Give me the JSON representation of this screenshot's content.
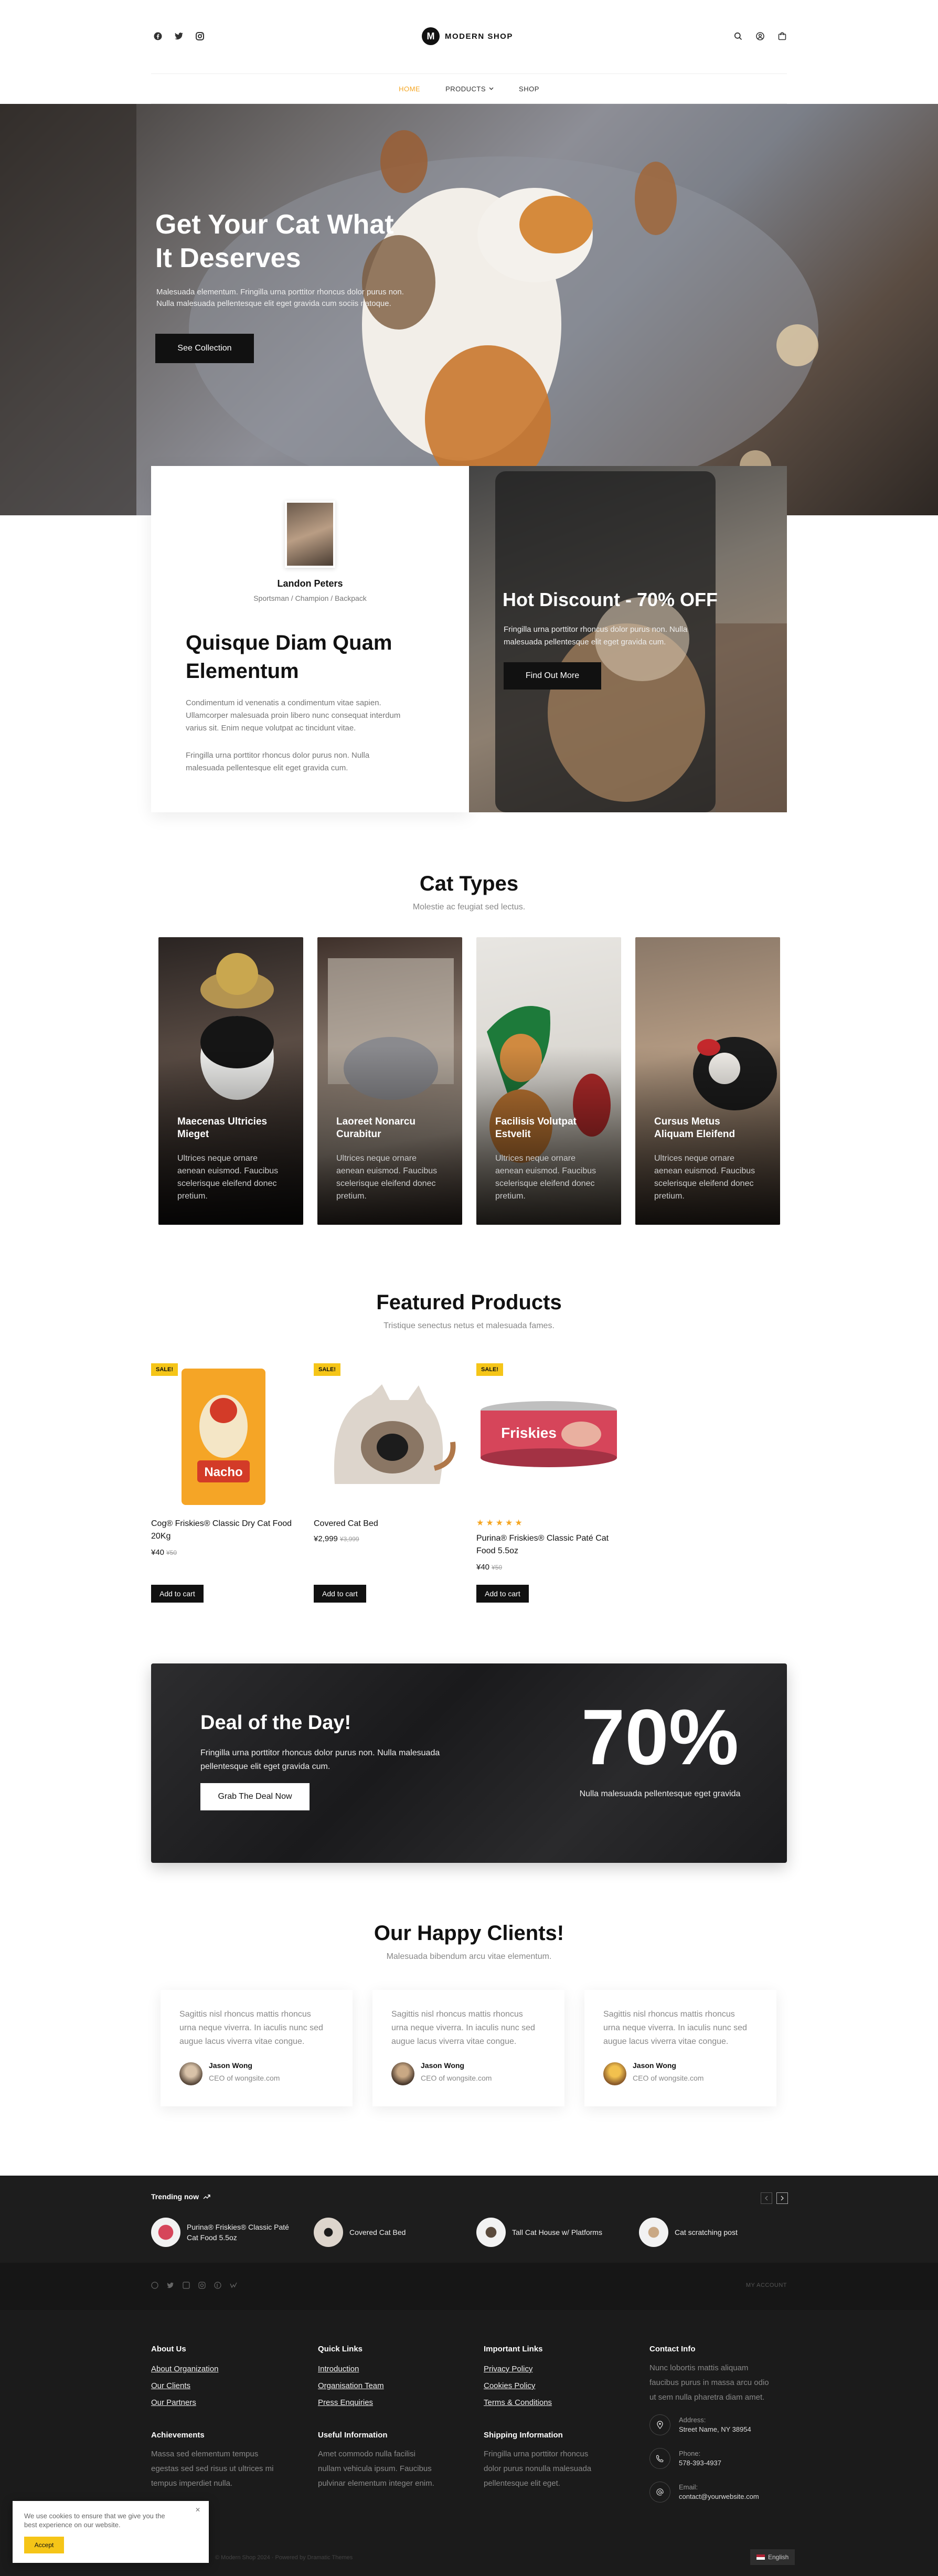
{
  "header": {
    "brand_mark": "M",
    "brand_name": "MODERN SHOP",
    "social_icons": [
      "facebook-icon",
      "twitter-icon",
      "instagram-icon"
    ],
    "utility_icons": [
      "search-icon",
      "account-icon",
      "cart-icon"
    ],
    "nav": [
      {
        "label": "HOME",
        "active": true
      },
      {
        "label": "PRODUCTS",
        "dropdown": true
      },
      {
        "label": "SHOP"
      }
    ]
  },
  "hero": {
    "title_line1": "Get Your Cat What",
    "title_line2": "It Deserves",
    "text_line1": "Malesuada elementum. Fringilla urna porttitor rhoncus dolor purus non.",
    "text_line2": "Nulla malesuada pellentesque elit eget gravida cum sociis natoque.",
    "button": "See Collection"
  },
  "profile": {
    "name": "Landon Peters",
    "role": "Sportsman / Champion / Backpack",
    "heading_line1": "Quisque Diam Quam",
    "heading_line2": "Elementum",
    "para1_line1": "Condimentum id venenatis a condimentum vitae sapien.",
    "para1_line2": "Ullamcorper malesuada proin libero nunc consequat interdum",
    "para1_line3": "varius sit. Enim neque volutpat ac tincidunt vitae.",
    "para2_line1": "Fringilla urna porttitor rhoncus dolor purus non. Nulla",
    "para2_line2": "malesuada pellentesque elit eget gravida cum."
  },
  "promo": {
    "title": "Hot Discount - 70% OFF",
    "text_line1": "Fringilla urna porttitor rhoncus dolor purus non. Nulla",
    "text_line2": "malesuada pellentesque elit eget gravida cum.",
    "button": "Find Out More"
  },
  "cat_types": {
    "title": "Cat Types",
    "subtitle": "Molestie ac feugiat sed lectus.",
    "cards": [
      {
        "title_line1": "Maecenas Ultricies",
        "title_line2": "Mieget",
        "desc": "Ultrices neque ornare aenean euismod. Faucibus scelerisque eleifend donec pretium.",
        "bg": "#3b3532"
      },
      {
        "title_line1": "Laoreet Nonarcu",
        "title_line2": "Curabitur",
        "desc": "Ultrices neque ornare aenean euismod. Faucibus scelerisque eleifend donec pretium.",
        "bg": "#6b5c54"
      },
      {
        "title_line1": "Facilisis Volutpat",
        "title_line2": "Estvelit",
        "desc": "Ultrices neque ornare aenean euismod. Faucibus scelerisque eleifend donec pretium.",
        "bg": "#8a8a86"
      },
      {
        "title_line1": "Cursus Metus",
        "title_line2": "Aliquam Eleifend",
        "desc": "Ultrices neque ornare aenean euismod. Faucibus scelerisque eleifend donec pretium.",
        "bg": "#6a5d4e"
      }
    ]
  },
  "featured": {
    "title": "Featured Products",
    "subtitle": "Tristique senectus netus et malesuada fames.",
    "sale_badge": "SALE!",
    "add_to_cart": "Add to cart",
    "products": [
      {
        "name_line1": "Cog® Friskies® Classic Dry Cat Food",
        "name_line2": "20Kg",
        "price": "¥40",
        "old_price": "¥50",
        "rating": 0
      },
      {
        "name_line1": "Covered Cat Bed",
        "name_line2": "",
        "price": "¥2,999",
        "old_price": "¥3,999",
        "rating": 0
      },
      {
        "name_line1": "Purina® Friskies® Classic Paté Cat",
        "name_line2": "Food 5.5oz",
        "price": "¥40",
        "old_price": "¥50",
        "rating": 5
      }
    ],
    "bag_text_brand": "Nacho",
    "can_text_brand": "Friskies"
  },
  "deal": {
    "title": "Deal of the Day!",
    "text_line1": "Fringilla urna porttitor rhoncus dolor purus non. Nulla malesuada",
    "text_line2": "pellentesque elit eget gravida cum.",
    "button": "Grab The Deal Now",
    "big": "70%",
    "big_caption": "Nulla malesuada pellentesque eget gravida"
  },
  "clients": {
    "title": "Our Happy Clients!",
    "subtitle": "Malesuada bibendum arcu vitae elementum.",
    "items": [
      {
        "quote_line1": "Sagittis nisl rhoncus mattis rhoncus",
        "quote_line2": "urna neque viverra. In iaculis nunc sed",
        "quote_line3": "augue lacus viverra vitae congue.",
        "name": "Jason Wong",
        "role": "CEO of wongsite.com"
      },
      {
        "quote_line1": "Sagittis nisl rhoncus mattis rhoncus",
        "quote_line2": "urna neque viverra. In iaculis nunc sed",
        "quote_line3": "augue lacus viverra vitae congue.",
        "name": "Jason Wong",
        "role": "CEO of wongsite.com"
      },
      {
        "quote_line1": "Sagittis nisl rhoncus mattis rhoncus",
        "quote_line2": "urna neque viverra. In iaculis nunc sed",
        "quote_line3": "augue lacus viverra vitae congue.",
        "name": "Jason Wong",
        "role": "CEO of wongsite.com"
      }
    ]
  },
  "trending": {
    "label": "Trending now",
    "items": [
      {
        "name_line1": "Purina® Friskies® Classic Paté",
        "name_line2": "Cat Food 5.5oz"
      },
      {
        "name_line1": "Covered Cat Bed",
        "name_line2": ""
      },
      {
        "name_line1": "Tall Cat House w/ Platforms",
        "name_line2": ""
      },
      {
        "name_line1": "Cat scratching post",
        "name_line2": ""
      }
    ]
  },
  "social_bar": {
    "icons": [
      "facebook-icon",
      "twitter-icon",
      "linkedin-icon",
      "instagram-icon",
      "pinterest-icon",
      "vimeo-icon"
    ],
    "account": "MY ACCOUNT"
  },
  "footer": {
    "about": {
      "heading": "About Us",
      "links": [
        "About Organization",
        "Our Clients",
        "Our Partners"
      ]
    },
    "quick": {
      "heading": "Quick Links",
      "links": [
        "Introduction",
        "Organisation Team",
        "Press Enquiries"
      ]
    },
    "important": {
      "heading": "Important Links",
      "links": [
        "Privacy Policy",
        "Cookies Policy",
        "Terms & Conditions"
      ]
    },
    "contact": {
      "heading": "Contact Info",
      "text_line1": "Nunc lobortis mattis aliquam",
      "text_line2": "faucibus purus in massa arcu odio",
      "text_line3": "ut sem nulla pharetra diam amet.",
      "address_label": "Address:",
      "address": "Street Name, NY 38954",
      "phone_label": "Phone:",
      "phone": "578-393-4937",
      "email_label": "Email:",
      "email": "contact@yourwebsite.com"
    },
    "achievements": {
      "heading": "Achievements",
      "line1": "Massa sed elementum tempus",
      "line2": "egestas sed sed risus ut ultrices mi",
      "line3": "tempus imperdiet nulla."
    },
    "useful": {
      "heading": "Useful Information",
      "line1": "Amet commodo nulla facilisi",
      "line2": "nullam vehicula ipsum. Faucibus",
      "line3": "pulvinar elementum integer enim."
    },
    "shipping": {
      "heading": "Shipping Information",
      "line1": "Fringilla urna porttitor rhoncus",
      "line2": "dolor purus nonulla malesuada",
      "line3": "pellentesque elit eget."
    },
    "copyright": "© Modern Shop 2024 · Powered by Dramatic Themes",
    "language": "English"
  },
  "cookie": {
    "text_line1": "We use cookies to ensure that we give you the",
    "text_line2": "best experience on our website.",
    "accept": "Accept"
  },
  "colors": {
    "accent": "#f5c518",
    "dark": "#111111",
    "footer": "#1b1b1b"
  }
}
